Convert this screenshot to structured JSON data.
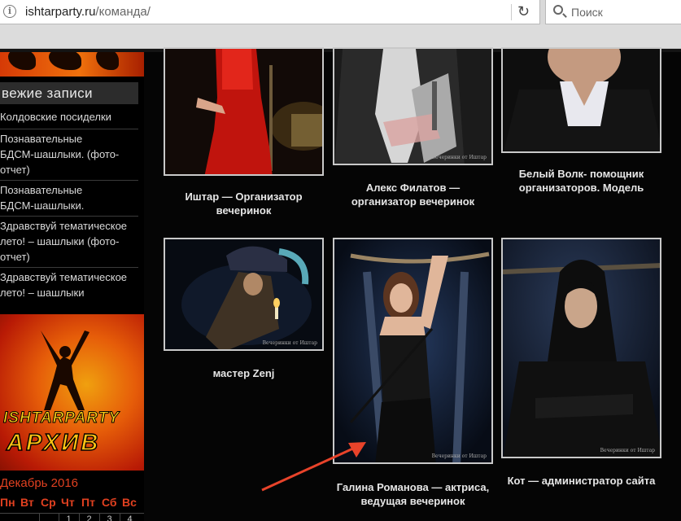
{
  "browser": {
    "url_domain": "ishtarparty.ru",
    "url_path": "/команда/",
    "search_placeholder": "Поиск"
  },
  "sidebar": {
    "recent_title": "вежие записи",
    "recent_posts": [
      {
        "label": "Колдовские посиделки"
      },
      {
        "label": "Познавательные"
      },
      {
        "label": "БДСМ-шашлыки. (фото-"
      },
      {
        "label": "отчет)"
      },
      {
        "label": "Познавательные"
      },
      {
        "label": "БДСМ-шашлыки."
      },
      {
        "label": "Здравствуй тематическое"
      },
      {
        "label": "лето! – шашлыки (фото-"
      },
      {
        "label": "отчет)"
      },
      {
        "label": "Здравствуй тематическое"
      },
      {
        "label": "лето! – шашлыки"
      }
    ],
    "archive_banner": {
      "line1": "ISHTARPARTY",
      "line2": "АРХИВ"
    },
    "calendar": {
      "month": "Декабрь 2016",
      "days": [
        "Пн",
        "Вт",
        "Ср",
        "Чт",
        "Пт",
        "Сб",
        "Вс"
      ],
      "first_row": [
        "",
        "",
        "1",
        "2",
        "3",
        "4"
      ]
    }
  },
  "team": [
    {
      "caption_l1": "Иштар — Организатор",
      "caption_l2": "вечеринок"
    },
    {
      "caption_l1": "Алекс Филатов —",
      "caption_l2": "организатор вечеринок",
      "watermark": "Вечеринки от Иштар"
    },
    {
      "caption_l1": "Белый Волк- помощник",
      "caption_l2": "организаторов. Модель"
    },
    {
      "caption_l1": "мастер Zenj",
      "caption_l2": "",
      "watermark": "Вечеринки от Иштар"
    },
    {
      "caption_l1": "Галина Романова — актриса,",
      "caption_l2": "ведущая вечеринок",
      "watermark": "Вечеринки от Иштар"
    },
    {
      "caption_l1": "Кот — администратор сайта",
      "caption_l2": "",
      "watermark": "Вечеринки от Иштар"
    }
  ],
  "colors": {
    "accent": "#e04020",
    "annotation_arrow": "#e8432a",
    "frame": "#c9c9c9"
  }
}
